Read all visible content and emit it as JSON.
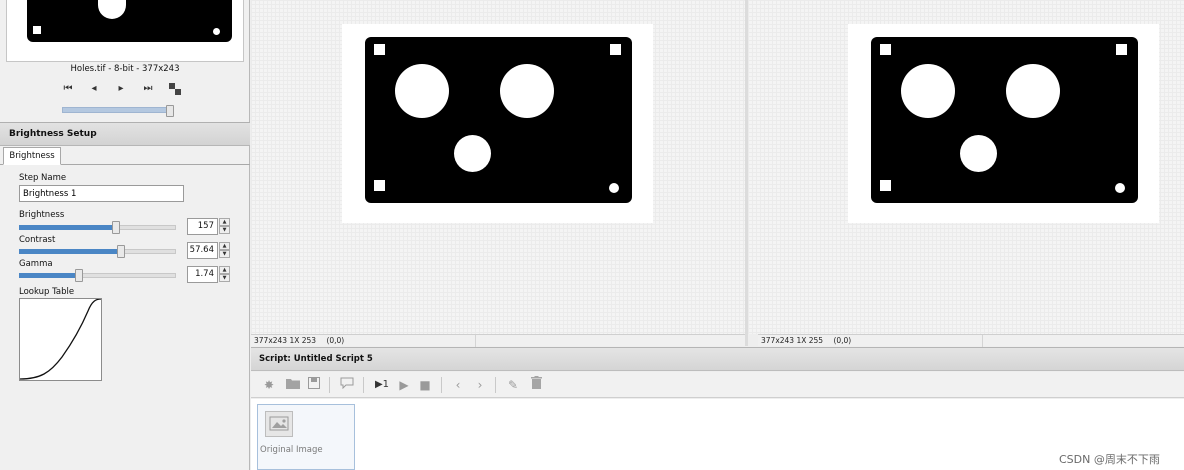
{
  "thumbnail": {
    "file_info": "Holes.tif - 8-bit - 377x243",
    "nav": {
      "first_icon": "first-frame-icon",
      "prev_icon": "prev-frame-icon",
      "next_icon": "next-frame-icon",
      "last_icon": "last-frame-icon",
      "stack_icon": "stack-icon"
    },
    "slider_level": 1.0
  },
  "brightness_setup": {
    "title": "Brightness Setup",
    "tab": "Brightness",
    "step_name_label": "Step Name",
    "step_name_value": "Brightness 1",
    "brightness_label": "Brightness",
    "brightness_value": "157",
    "brightness_level": 0.62,
    "contrast_label": "Contrast",
    "contrast_value": "57.64",
    "contrast_level": 0.65,
    "gamma_label": "Gamma",
    "gamma_value": "1.74",
    "gamma_level": 0.38,
    "lut_label": "Lookup Table"
  },
  "viewers": {
    "left_status_size": "377x243 1X 253",
    "left_status_coords": "(0,0)",
    "right_status_size": "377x243 1X 255",
    "right_status_coords": "(0,0)"
  },
  "script": {
    "title": "Script: Untitled Script 5",
    "toolbar": {
      "new_icon": "new-script-icon",
      "open_icon": "open-folder-icon",
      "save_icon": "save-icon",
      "comment_icon": "comment-icon",
      "run_once_label": "▶1",
      "run_icon": "play-icon",
      "stop_icon": "stop-icon",
      "back_icon": "chevron-left-icon",
      "forward_icon": "chevron-right-icon",
      "edit_icon": "pencil-icon",
      "delete_icon": "trash-icon"
    },
    "steps": [
      {
        "label": "Original Image",
        "icon": "image-icon"
      }
    ]
  },
  "watermark": "CSDN @周末不下雨",
  "colors": {
    "slider_fill": "#4a86c5",
    "thumb_slider": "#b4c8e0",
    "step_card_border": "#a7c0dc"
  }
}
